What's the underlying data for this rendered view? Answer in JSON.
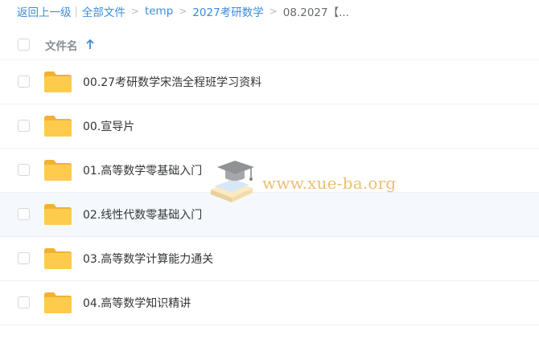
{
  "breadcrumb": {
    "back_label": "返回上一级",
    "all_files_label": "全部文件",
    "path": [
      "temp",
      "2027考研数学"
    ],
    "current": "08.2027【..."
  },
  "header": {
    "name_column": "文件名"
  },
  "files": [
    {
      "name": "00.27考研数学宋浩全程班学习资料",
      "type": "folder"
    },
    {
      "name": "00.宣导片",
      "type": "folder"
    },
    {
      "name": "01.高等数学零基础入门",
      "type": "folder"
    },
    {
      "name": "02.线性代数零基础入门",
      "type": "folder",
      "hovered": true
    },
    {
      "name": "03.高等数学计算能力通关",
      "type": "folder"
    },
    {
      "name": "04.高等数学知识精讲",
      "type": "folder"
    }
  ],
  "watermark": {
    "text": "www.xue-ba.org"
  },
  "colors": {
    "link": "#3b8cdb",
    "folder": "#ffc94a",
    "hover_row": "#f5f9fe",
    "watermark": "#e8b45a"
  }
}
